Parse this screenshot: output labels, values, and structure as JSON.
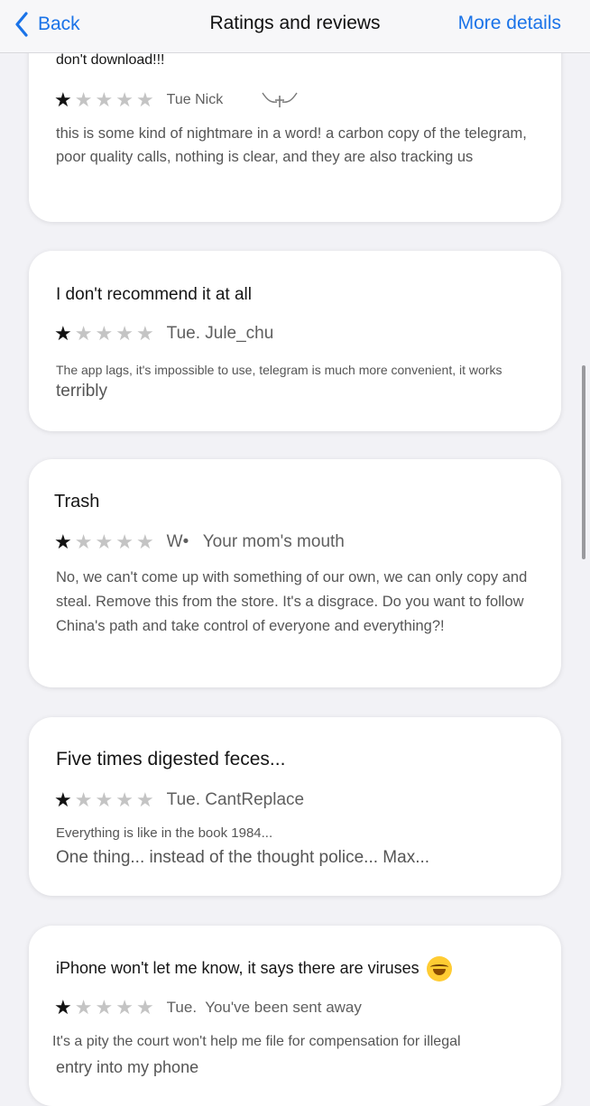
{
  "nav": {
    "back_label": "Back",
    "title": "Ratings and reviews",
    "more_label": "More details"
  },
  "reviews": [
    {
      "title": "don't download!!!",
      "stars": 1,
      "meta": "Tue Nick",
      "body": "this is some kind of nightmare in a word! a carbon copy of the telegram, poor quality calls, nothing is clear, and they are also tracking us"
    },
    {
      "title": "I don't recommend it at all",
      "stars": 1,
      "meta": "Tue. Jule_chu",
      "body_line1": "The app lags, it's impossible to use, telegram is much more convenient, it works",
      "body_line2": "terribly"
    },
    {
      "title": "Trash",
      "stars": 1,
      "meta": "W•   Your mom's mouth",
      "body": "No, we can't come up with something of our own, we can only copy and steal. Remove this from the store. It's a disgrace. Do you want to follow China's path and take control of everyone and everything?!"
    },
    {
      "title": "Five times digested feces...",
      "stars": 1,
      "meta": "Tue. CantReplace",
      "body_line1": "Everything is like in the book 1984...",
      "body_line2": "One thing... instead of the thought police... Max..."
    },
    {
      "title": "iPhone won't let me know, it says there are viruses",
      "title_emoji": "laughing-with-tears",
      "stars": 1,
      "meta": "Tue.  You've been sent away",
      "body_line1": "It's a pity the court won't help me file for compensation for illegal",
      "body_line2": "entry into my phone"
    }
  ],
  "star_glyph": "★",
  "colors": {
    "accent": "#1a73e8",
    "star_on": "#121212",
    "star_off": "#c4c4c4"
  }
}
